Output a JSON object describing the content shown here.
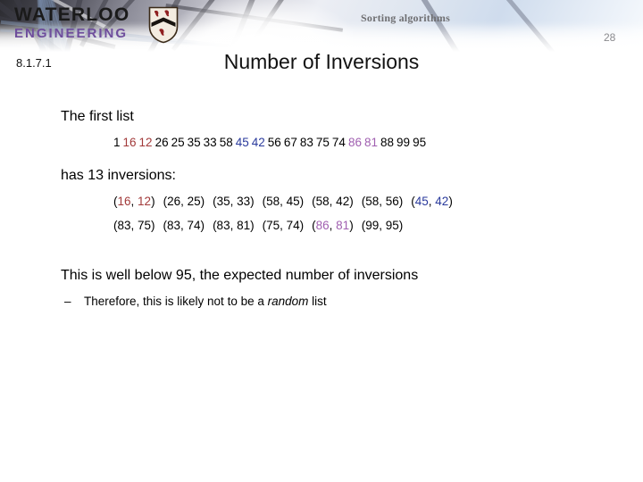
{
  "header": {
    "logo_line1": "WATERLOO",
    "logo_line2": "ENGINEERING",
    "crest_icon": "waterloo-shield-crest-icon",
    "course_label": "Sorting algorithms",
    "page_number": "28",
    "section_number": "8.1.7.1",
    "slide_title": "Number of Inversions"
  },
  "colors": {
    "accent_red": "#a23a3a",
    "accent_blue": "#2a3a9c",
    "accent_purple": "#a05fb0",
    "brand_purple": "#6e4d9c",
    "text": "#000000",
    "muted": "#8a8a8e"
  },
  "body": {
    "intro": "The first list",
    "sequence": [
      {
        "value": "1",
        "color": "black"
      },
      {
        "value": "16",
        "color": "red"
      },
      {
        "value": "12",
        "color": "red"
      },
      {
        "value": "26",
        "color": "black"
      },
      {
        "value": "25",
        "color": "black"
      },
      {
        "value": "35",
        "color": "black"
      },
      {
        "value": "33",
        "color": "black"
      },
      {
        "value": "58",
        "color": "black"
      },
      {
        "value": "45",
        "color": "blue"
      },
      {
        "value": "42",
        "color": "blue"
      },
      {
        "value": "56",
        "color": "black"
      },
      {
        "value": "67",
        "color": "black"
      },
      {
        "value": "83",
        "color": "black"
      },
      {
        "value": "75",
        "color": "black"
      },
      {
        "value": "74",
        "color": "black"
      },
      {
        "value": "86",
        "color": "purple"
      },
      {
        "value": "81",
        "color": "purple"
      },
      {
        "value": "88",
        "color": "black"
      },
      {
        "value": "99",
        "color": "black"
      },
      {
        "value": "95",
        "color": "black"
      }
    ],
    "inversion_count_text": "has 13 inversions:",
    "inversion_rows": [
      [
        {
          "text": "(16, 12)",
          "color": "red"
        },
        {
          "text": "(26, 25)",
          "color": "black"
        },
        {
          "text": "(35, 33)",
          "color": "black"
        },
        {
          "text": "(58, 45)",
          "color": "black"
        },
        {
          "text": "(58, 42)",
          "color": "black"
        },
        {
          "text": "(58, 56)",
          "color": "black"
        },
        {
          "text": "(45, 42)",
          "color": "blue"
        }
      ],
      [
        {
          "text": "(83, 75)",
          "color": "black"
        },
        {
          "text": "(83, 74)",
          "color": "black"
        },
        {
          "text": "(83, 81)",
          "color": "black"
        },
        {
          "text": "(75, 74)",
          "color": "black"
        },
        {
          "text": "(86, 81)",
          "color": "purple"
        },
        {
          "text": "(99, 95)",
          "color": "black"
        }
      ]
    ],
    "conclusion": "This is well below 95, the expected number of inversions",
    "sub_bullet_dash": "–",
    "sub_bullet_pre": "Therefore, this is likely not to be a ",
    "sub_bullet_italic": "random",
    "sub_bullet_post": " list"
  }
}
